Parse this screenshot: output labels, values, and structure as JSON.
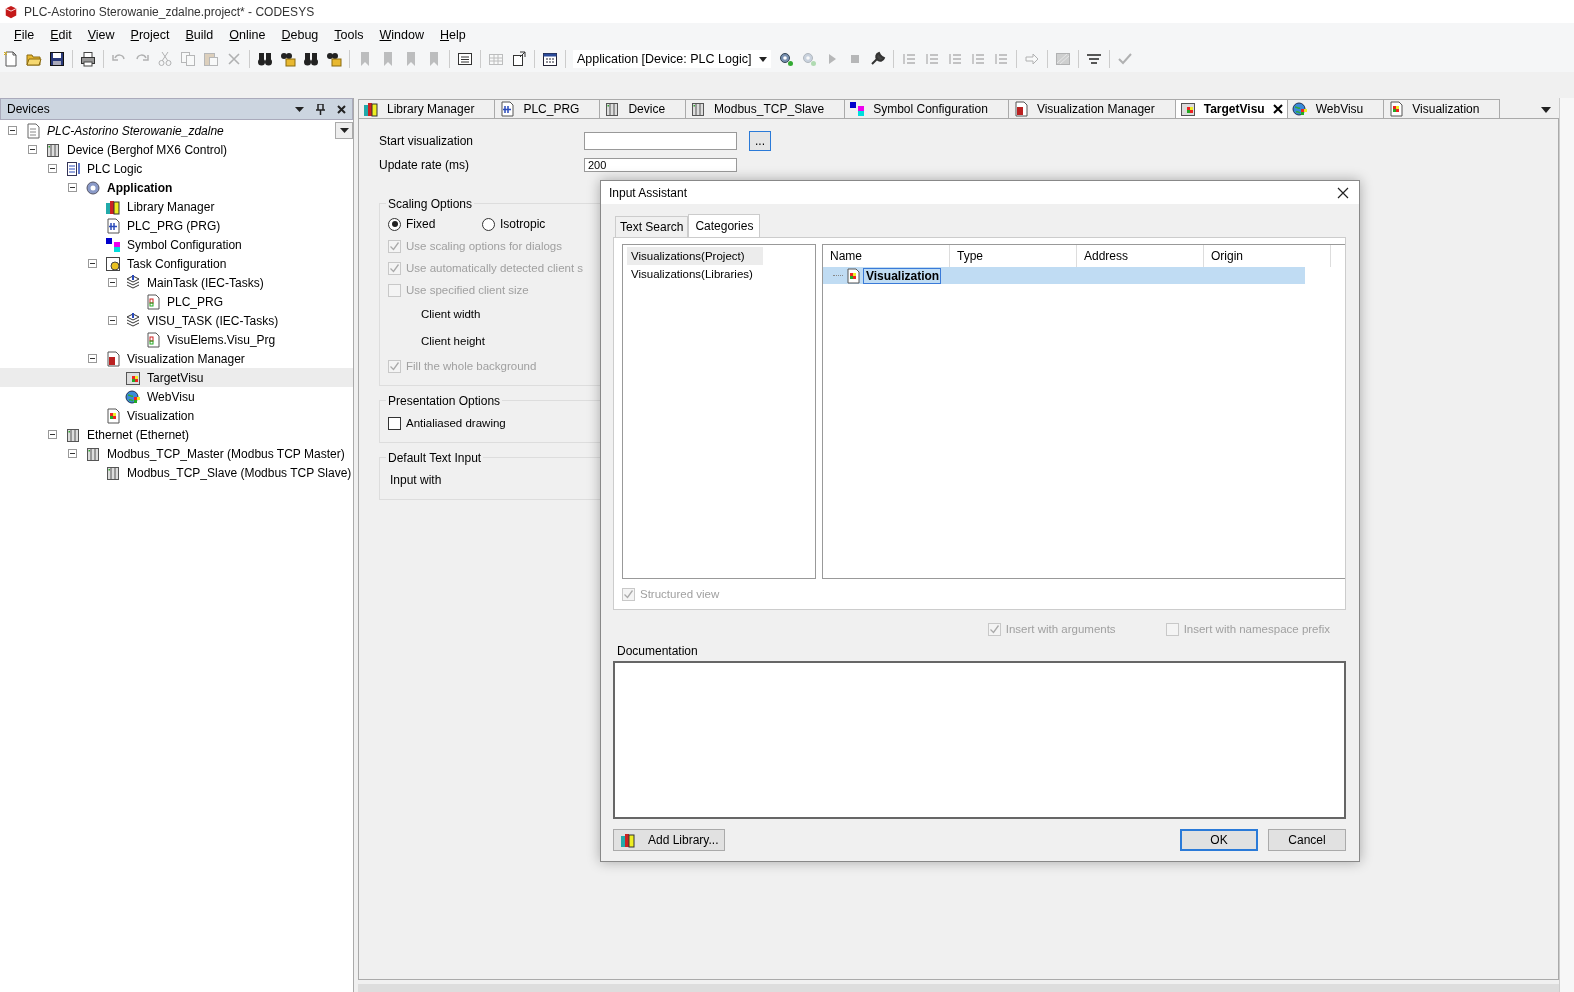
{
  "window": {
    "title": "PLC-Astorino Sterowanie_zdalne.project* - CODESYS"
  },
  "menu": [
    "File",
    "Edit",
    "View",
    "Project",
    "Build",
    "Online",
    "Debug",
    "Tools",
    "Window",
    "Help"
  ],
  "toolbar": [
    {
      "kind": "new",
      "disabled": false
    },
    {
      "kind": "open",
      "disabled": false
    },
    {
      "kind": "save",
      "disabled": false
    },
    {
      "kind": "sep"
    },
    {
      "kind": "print",
      "disabled": false
    },
    {
      "kind": "sep"
    },
    {
      "kind": "undo",
      "disabled": true
    },
    {
      "kind": "redo",
      "disabled": true
    },
    {
      "kind": "cut",
      "disabled": true
    },
    {
      "kind": "copy",
      "disabled": true
    },
    {
      "kind": "paste",
      "disabled": true
    },
    {
      "kind": "delete",
      "disabled": true
    },
    {
      "kind": "sep"
    },
    {
      "kind": "find",
      "disabled": false
    },
    {
      "kind": "replace",
      "disabled": false
    },
    {
      "kind": "find",
      "disabled": false
    },
    {
      "kind": "replace",
      "disabled": false
    },
    {
      "kind": "sep"
    },
    {
      "kind": "bookmark",
      "disabled": true
    },
    {
      "kind": "bookmark",
      "disabled": true
    },
    {
      "kind": "bookmark",
      "disabled": true
    },
    {
      "kind": "bookmark",
      "disabled": true
    },
    {
      "kind": "sep"
    },
    {
      "kind": "clipboard",
      "disabled": false
    },
    {
      "kind": "sep"
    },
    {
      "kind": "grid",
      "disabled": true
    },
    {
      "kind": "window",
      "disabled": false
    },
    {
      "kind": "sep"
    },
    {
      "kind": "calendar",
      "disabled": false
    },
    {
      "kind": "sep"
    },
    {
      "kind": "combo",
      "value": "Application [Device: PLC Logic]"
    },
    {
      "kind": "gear",
      "disabled": false
    },
    {
      "kind": "gear",
      "disabled": true
    },
    {
      "kind": "play",
      "disabled": true
    },
    {
      "kind": "stop",
      "disabled": true
    },
    {
      "kind": "wrench",
      "disabled": false
    },
    {
      "kind": "sep"
    },
    {
      "kind": "step",
      "disabled": true
    },
    {
      "kind": "step",
      "disabled": true
    },
    {
      "kind": "step",
      "disabled": true
    },
    {
      "kind": "step",
      "disabled": true
    },
    {
      "kind": "step",
      "disabled": true
    },
    {
      "kind": "sep"
    },
    {
      "kind": "arrow",
      "disabled": true
    },
    {
      "kind": "sep"
    },
    {
      "kind": "hatch",
      "disabled": true
    },
    {
      "kind": "sep"
    },
    {
      "kind": "filter",
      "disabled": false
    },
    {
      "kind": "sep"
    },
    {
      "kind": "check",
      "disabled": true
    }
  ],
  "devices": {
    "title": "Devices",
    "tree": [
      {
        "label": "PLC-Astorino Sterowanie_zdalne",
        "kind": "project",
        "active": false,
        "selected": false,
        "expanded": true,
        "children": [
          {
            "label": "Device (Berghof MX6 Control)",
            "kind": "device",
            "active": false,
            "selected": false,
            "expanded": true,
            "children": [
              {
                "label": "PLC Logic",
                "kind": "logic",
                "active": false,
                "selected": false,
                "expanded": true,
                "children": [
                  {
                    "label": "Application",
                    "kind": "application",
                    "active": true,
                    "selected": false,
                    "expanded": true,
                    "children": [
                      {
                        "label": "Library Manager",
                        "kind": "library",
                        "active": false,
                        "selected": false
                      },
                      {
                        "label": "PLC_PRG (PRG)",
                        "kind": "pou",
                        "active": false,
                        "selected": false
                      },
                      {
                        "label": "Symbol Configuration",
                        "kind": "symbols",
                        "active": false,
                        "selected": false
                      },
                      {
                        "label": "Task Configuration",
                        "kind": "taskconfig",
                        "active": false,
                        "selected": false,
                        "expanded": true,
                        "children": [
                          {
                            "label": "MainTask (IEC-Tasks)",
                            "kind": "task",
                            "active": false,
                            "selected": false,
                            "expanded": true,
                            "children": [
                              {
                                "label": "PLC_PRG",
                                "kind": "call",
                                "active": false,
                                "selected": false
                              }
                            ]
                          },
                          {
                            "label": "VISU_TASK (IEC-Tasks)",
                            "kind": "task",
                            "active": false,
                            "selected": false,
                            "expanded": true,
                            "children": [
                              {
                                "label": "VisuElems.Visu_Prg",
                                "kind": "call",
                                "active": false,
                                "selected": false
                              }
                            ]
                          }
                        ]
                      },
                      {
                        "label": "Visualization Manager",
                        "kind": "visumanager",
                        "active": false,
                        "selected": false,
                        "expanded": true,
                        "children": [
                          {
                            "label": "TargetVisu",
                            "kind": "targetvisu",
                            "active": false,
                            "selected": true
                          },
                          {
                            "label": "WebVisu",
                            "kind": "webvisu",
                            "active": false,
                            "selected": false
                          }
                        ]
                      },
                      {
                        "label": "Visualization",
                        "kind": "visu",
                        "active": false,
                        "selected": false
                      }
                    ]
                  }
                ]
              },
              {
                "label": "Ethernet (Ethernet)",
                "kind": "device",
                "active": false,
                "selected": false,
                "expanded": true,
                "children": [
                  {
                    "label": "Modbus_TCP_Master (Modbus TCP Master)",
                    "kind": "device",
                    "active": false,
                    "selected": false,
                    "expanded": true,
                    "children": [
                      {
                        "label": "Modbus_TCP_Slave (Modbus TCP Slave)",
                        "kind": "device",
                        "active": false,
                        "selected": false
                      }
                    ]
                  }
                ]
              }
            ]
          }
        ]
      }
    ]
  },
  "tabs": [
    {
      "label": "Library Manager",
      "kind": "library",
      "selected": false
    },
    {
      "label": "PLC_PRG",
      "kind": "pou",
      "selected": false
    },
    {
      "label": "Device",
      "kind": "device",
      "selected": false
    },
    {
      "label": "Modbus_TCP_Slave",
      "kind": "device",
      "selected": false
    },
    {
      "label": "Symbol Configuration",
      "kind": "symbols",
      "selected": false
    },
    {
      "label": "Visualization Manager",
      "kind": "visumanager",
      "selected": false
    },
    {
      "label": "TargetVisu",
      "kind": "targetvisu",
      "selected": true
    },
    {
      "label": "WebVisu",
      "kind": "webvisu",
      "selected": false
    },
    {
      "label": "Visualization",
      "kind": "visu",
      "selected": false
    }
  ],
  "editor": {
    "start_visualization": {
      "label": "Start visualization",
      "button": "..."
    },
    "update_rate": {
      "label": "Update rate (ms)",
      "value": "200"
    },
    "scaling": {
      "title": "Scaling Options",
      "radios": [
        {
          "label": "Fixed",
          "selected": true
        },
        {
          "label": "Isotropic",
          "selected": false
        }
      ],
      "checks": [
        {
          "label": "Use scaling options for dialogs",
          "checked": true,
          "disabled": true
        },
        {
          "label": "Use automatically detected client s",
          "checked": true,
          "disabled": true
        },
        {
          "label": "Use specified client size",
          "checked": false,
          "disabled": true
        }
      ],
      "client_width": "Client width",
      "client_height": "Client height",
      "fill": {
        "label": "Fill the whole background",
        "checked": true,
        "disabled": true
      }
    },
    "presentation": {
      "title": "Presentation Options",
      "antialiased": {
        "label": "Antialiased drawing",
        "checked": false,
        "disabled": false
      }
    },
    "text_input": {
      "title": "Default Text Input",
      "input_with": "Input with"
    }
  },
  "dialog": {
    "title": "Input Assistant",
    "tabs": [
      {
        "label": "Text Search",
        "selected": false
      },
      {
        "label": "Categories",
        "selected": true
      }
    ],
    "categories": [
      {
        "label": "Visualizations(Project)",
        "selected": true
      },
      {
        "label": "Visualizations(Libraries)",
        "selected": false
      }
    ],
    "columns": [
      "Name",
      "Type",
      "Address",
      "Origin"
    ],
    "rows": [
      {
        "name": "Visualization",
        "selected": true
      }
    ],
    "structured_view": {
      "label": "Structured view",
      "checked": true,
      "disabled": true
    },
    "insert_arguments": {
      "label": "Insert with arguments",
      "checked": true,
      "disabled": true
    },
    "insert_namespace": {
      "label": "Insert with namespace prefix",
      "checked": false,
      "disabled": true
    },
    "documentation": {
      "label": "Documentation"
    },
    "add_library": "Add Library...",
    "ok": "OK",
    "cancel": "Cancel"
  }
}
